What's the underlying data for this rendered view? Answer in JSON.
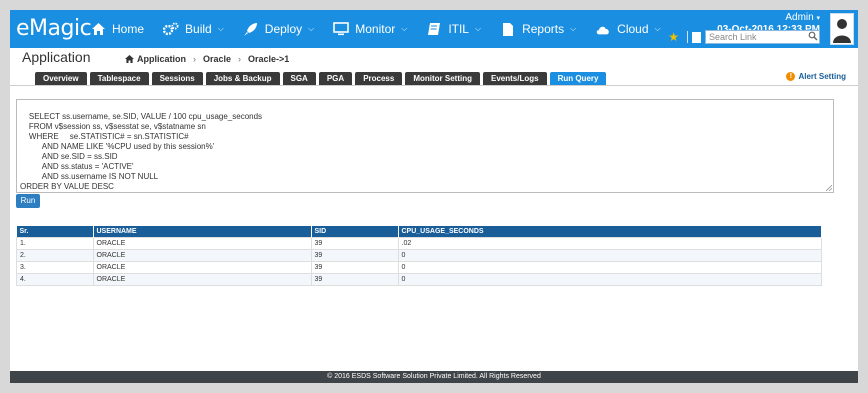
{
  "brand": {
    "logo_text": "eMagic"
  },
  "nav": [
    {
      "label": "Home",
      "icon": "home-icon",
      "has_caret": false
    },
    {
      "label": "Build",
      "icon": "gears-icon",
      "has_caret": true
    },
    {
      "label": "Deploy",
      "icon": "rocket-icon",
      "has_caret": true
    },
    {
      "label": "Monitor",
      "icon": "monitor-icon",
      "has_caret": true
    },
    {
      "label": "ITIL",
      "icon": "book-icon",
      "has_caret": true
    },
    {
      "label": "Reports",
      "icon": "document-icon",
      "has_caret": true
    },
    {
      "label": "Cloud",
      "icon": "cloud-icon",
      "has_caret": true
    }
  ],
  "user": {
    "name": "Admin",
    "datetime": "03-Oct-2016 12:33 PM",
    "search_placeholder": "Search Link"
  },
  "page": {
    "title": "Application",
    "breadcrumbs": [
      "Application",
      "Oracle",
      "Oracle->1"
    ]
  },
  "tabs": [
    {
      "label": "Overview",
      "active": false
    },
    {
      "label": "Tablespace",
      "active": false
    },
    {
      "label": "Sessions",
      "active": false
    },
    {
      "label": "Jobs & Backup",
      "active": false
    },
    {
      "label": "SGA",
      "active": false
    },
    {
      "label": "PGA",
      "active": false
    },
    {
      "label": "Process",
      "active": false
    },
    {
      "label": "Monitor Setting",
      "active": false
    },
    {
      "label": "Events/Logs",
      "active": false
    },
    {
      "label": "Run Query",
      "active": true
    }
  ],
  "alert_setting_label": "Alert Setting",
  "query_text": "SELECT ss.username, se.SID, VALUE / 100 cpu_usage_seconds\n    FROM v$session ss, v$sesstat se, v$statname sn\n    WHERE     se.STATISTIC# = sn.STATISTIC#\n          AND NAME LIKE '%CPU used by this session%'\n          AND se.SID = ss.SID\n          AND ss.status = 'ACTIVE'\n          AND ss.username IS NOT NULL\nORDER BY VALUE DESC",
  "run_button_label": "Run",
  "results": {
    "headers": [
      "Sr.",
      "USERNAME",
      "SID",
      "CPU_USAGE_SECONDS"
    ],
    "rows": [
      [
        "1.",
        "ORACLE",
        "39",
        ".02"
      ],
      [
        "2.",
        "ORACLE",
        "39",
        "0"
      ],
      [
        "3.",
        "ORACLE",
        "39",
        "0"
      ],
      [
        "4.",
        "ORACLE",
        "39",
        "0"
      ]
    ]
  },
  "footer_text": "© 2016 ESDS Software Solution Private Limited. All Rights Reserved"
}
